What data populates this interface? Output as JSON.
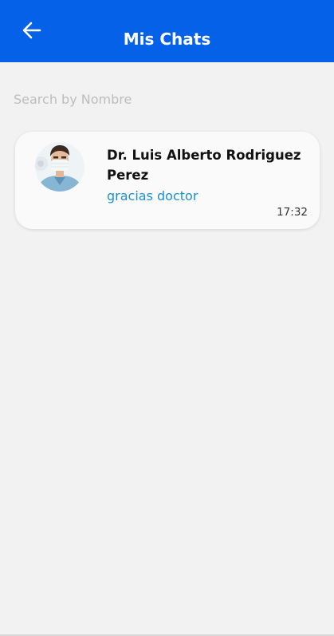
{
  "header": {
    "title": "Mis Chats",
    "back_icon": "arrow-left-icon",
    "background_color": "#0562e8"
  },
  "search": {
    "value": "",
    "placeholder": "Search by Nombre"
  },
  "chats": [
    {
      "name": "Dr. Luis Alberto Rodriguez Perez",
      "last_message": "gracias doctor",
      "time": "17:32",
      "message_color": "#1a8fd6"
    }
  ]
}
